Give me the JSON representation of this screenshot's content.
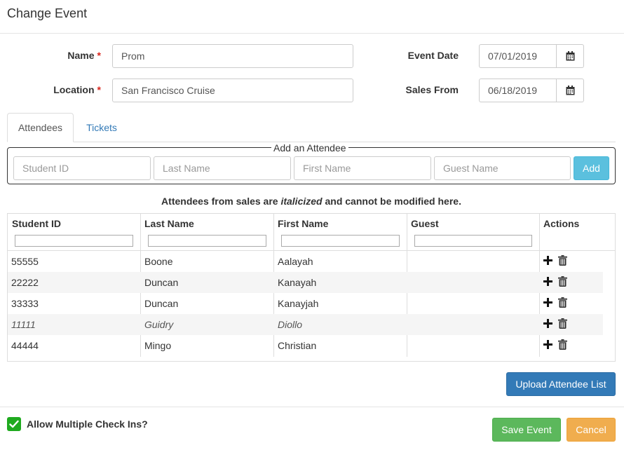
{
  "modal": {
    "title": "Change Event"
  },
  "form": {
    "name_label": "Name",
    "name_value": "Prom",
    "location_label": "Location",
    "location_value": "San Francisco Cruise",
    "event_date_label": "Event Date",
    "event_date_value": "07/01/2019",
    "sales_from_label": "Sales From",
    "sales_from_value": "06/18/2019",
    "required_mark": "*",
    "calendar_icon": "calendar-icon"
  },
  "tabs": [
    {
      "label": "Attendees",
      "active": true
    },
    {
      "label": "Tickets",
      "active": false
    }
  ],
  "add_attendee": {
    "legend": "Add an Attendee",
    "student_id_placeholder": "Student ID",
    "last_name_placeholder": "Last Name",
    "first_name_placeholder": "First Name",
    "guest_name_placeholder": "Guest Name",
    "add_label": "Add"
  },
  "note": {
    "before": "Attendees from sales are ",
    "emph": "italicized",
    "after": " and cannot be modified here."
  },
  "grid": {
    "columns": [
      "Student ID",
      "Last Name",
      "First Name",
      "Guest",
      "Actions"
    ],
    "rows": [
      {
        "student_id": "55555",
        "last_name": "Boone",
        "first_name": "Aalayah",
        "guest": "",
        "italic": false
      },
      {
        "student_id": "22222",
        "last_name": "Duncan",
        "first_name": "Kanayah",
        "guest": "",
        "italic": false
      },
      {
        "student_id": "33333",
        "last_name": "Duncan",
        "first_name": "Kanayjah",
        "guest": "",
        "italic": false
      },
      {
        "student_id": "11111",
        "last_name": "Guidry",
        "first_name": "Diollo",
        "guest": "",
        "italic": true
      },
      {
        "student_id": "44444",
        "last_name": "Mingo",
        "first_name": "Christian",
        "guest": "",
        "italic": false
      }
    ],
    "row_actions": [
      "plus-icon",
      "trash-icon"
    ]
  },
  "upload_label": "Upload Attendee List",
  "footer": {
    "allow_multiple_label": "Allow Multiple Check Ins?",
    "allow_multiple_checked": true,
    "save_label": "Save Event",
    "cancel_label": "Cancel"
  },
  "colors": {
    "primary": "#337ab7",
    "info": "#5bc0de",
    "success": "#5cb85c",
    "warning": "#f0ad4e",
    "required": "#d9251c",
    "checkbox": "#1faa1f"
  }
}
